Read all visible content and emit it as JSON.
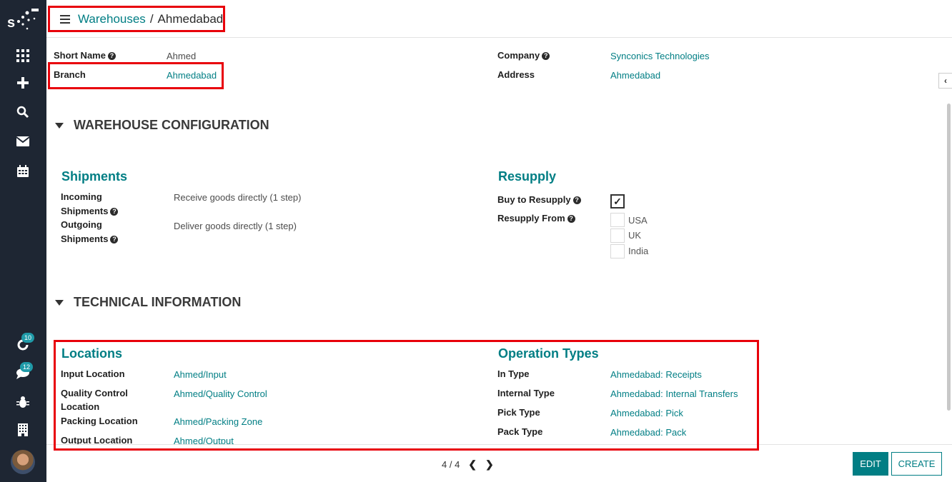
{
  "sidebar": {
    "logo_text": "s",
    "badges": {
      "activity": "10",
      "messages": "12"
    }
  },
  "breadcrumb": {
    "parent": "Warehouses",
    "separator": "/",
    "current": "Ahmedabad"
  },
  "fields": {
    "short_name_label": "Short Name",
    "short_name_value": "Ahmed",
    "branch_label": "Branch",
    "branch_value": "Ahmedabad",
    "company_label": "Company",
    "company_value": "Synconics Technologies",
    "address_label": "Address",
    "address_value": "Ahmedabad"
  },
  "warehouse_config": {
    "title": "WAREHOUSE CONFIGURATION",
    "shipments": {
      "title": "Shipments",
      "incoming_label_1": "Incoming",
      "incoming_label_2": "Shipments",
      "incoming_value": "Receive goods directly (1 step)",
      "outgoing_label_1": "Outgoing",
      "outgoing_label_2": "Shipments",
      "outgoing_value": "Deliver goods directly (1 step)"
    },
    "resupply": {
      "title": "Resupply",
      "buy_label": "Buy to Resupply",
      "buy_checked": true,
      "from_label": "Resupply From",
      "options": [
        "USA",
        "UK",
        "India"
      ]
    }
  },
  "technical_info": {
    "title": "TECHNICAL INFORMATION",
    "locations": {
      "title": "Locations",
      "input_label": "Input Location",
      "input_value": "Ahmed/Input",
      "qc_label_1": "Quality Control",
      "qc_label_2": "Location",
      "qc_value": "Ahmed/Quality Control",
      "packing_label": "Packing Location",
      "packing_value": "Ahmed/Packing Zone",
      "output_label": "Output Location",
      "output_value": "Ahmed/Output"
    },
    "operation_types": {
      "title": "Operation Types",
      "in_label": "In Type",
      "in_value": "Ahmedabad: Receipts",
      "internal_label": "Internal Type",
      "internal_value": "Ahmedabad: Internal Transfers",
      "pick_label": "Pick Type",
      "pick_value": "Ahmedabad: Pick",
      "pack_label": "Pack Type",
      "pack_value": "Ahmedabad: Pack"
    }
  },
  "footer": {
    "pager": "4 / 4",
    "edit_label": "EDIT",
    "create_label": "CREATE"
  },
  "colors": {
    "accent": "#017e84",
    "sidebar": "#1e2633",
    "highlight": "#e8000a"
  }
}
